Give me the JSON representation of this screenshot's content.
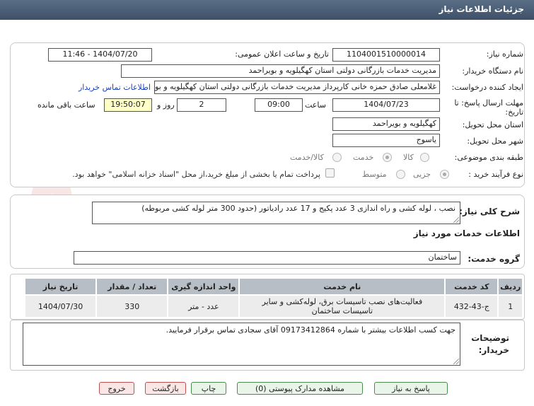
{
  "page": {
    "title": "جزئیات اطلاعات نیاز"
  },
  "header": {
    "need_number_label": "شماره نیاز:",
    "need_number": "1104001510000014",
    "announce_label": "تاریخ و ساعت اعلان عمومی:",
    "announce_value": "1404/07/20 - 11:46",
    "buyer_org_label": "نام دستگاه خریدار:",
    "buyer_org": "مدیریت خدمات بازرگانی دولتی استان کهگیلویه و بویراحمد",
    "creator_label": "ایجاد کننده درخواست:",
    "creator": "غلامعلی صادق حمزه خانی کارپرداز مدیریت خدمات بازرگانی دولتی استان کهگیلویه و بویراحمد",
    "contact_link": "اطلاعات تماس خریدار",
    "deadline_label": "مهلت ارسال پاسخ: تا تاریخ:",
    "deadline_date": "1404/07/23",
    "time_label": "ساعت",
    "deadline_time": "09:00",
    "days_value": "2",
    "days_label": "روز و",
    "remaining_time": "19:50:07",
    "remaining_label": "ساعت باقی مانده",
    "province_label": "استان محل تحویل:",
    "province": "کهگیلویه و بویراحمد",
    "city_label": "شهر محل تحویل:",
    "city": "یاسوج",
    "category_label": "طبقه بندی موضوعی:",
    "category_options": [
      "کالا",
      "خدمت",
      "کالا/خدمت"
    ],
    "category_selected": "خدمت",
    "process_label": "نوع فرآیند خرید :",
    "process_options": [
      "جزیی",
      "متوسط"
    ],
    "process_selected": "جزیی",
    "payment_note": "پرداخت تمام یا بخشی از مبلغ خرید،از محل \"اسناد خزانه اسلامی\" خواهد بود."
  },
  "summary": {
    "label": "شرح کلی نیاز:",
    "value": "نصب ، لوله کشی و راه اندازی 3 عدد پکیج و 17 عدد رادیاتور (حدود 300 متر لوله کشی مربوطه)"
  },
  "services": {
    "section_title": "اطلاعات خدمات مورد نیاز",
    "group_label": "گروه خدمت:",
    "group_value": "ساختمان",
    "columns": [
      "ردیف",
      "کد خدمت",
      "نام خدمت",
      "واحد اندازه گیری",
      "تعداد / مقدار",
      "تاریخ نیاز"
    ],
    "rows": [
      {
        "row": "1",
        "code": "ج-43-432",
        "name_line1": "فعالیت‌های نصب تاسیسات برق، لوله‌کشی و سایر",
        "name_line2": "تاسیسات ساختمان",
        "unit": "عدد - متر",
        "qty": "330",
        "date": "1404/07/30"
      }
    ]
  },
  "notes": {
    "label_line1": "توضیحات",
    "label_line2": "خریدار:",
    "value": "جهت کسب اطلاعات بیشتر با شماره 09173412864 آقای سجادی تماس برقرار فرمایید."
  },
  "buttons": {
    "reply": "پاسخ به نیاز",
    "attachments": "مشاهده مدارک پیوستی (0)",
    "print": "چاپ",
    "back": "بازگشت",
    "exit": "خروج"
  },
  "watermark": {
    "text": "AriaTender.net"
  },
  "colors": {
    "title_bar": "#4a5e77",
    "yellow_field": "#ffffc8",
    "link": "#1a3fbf"
  }
}
